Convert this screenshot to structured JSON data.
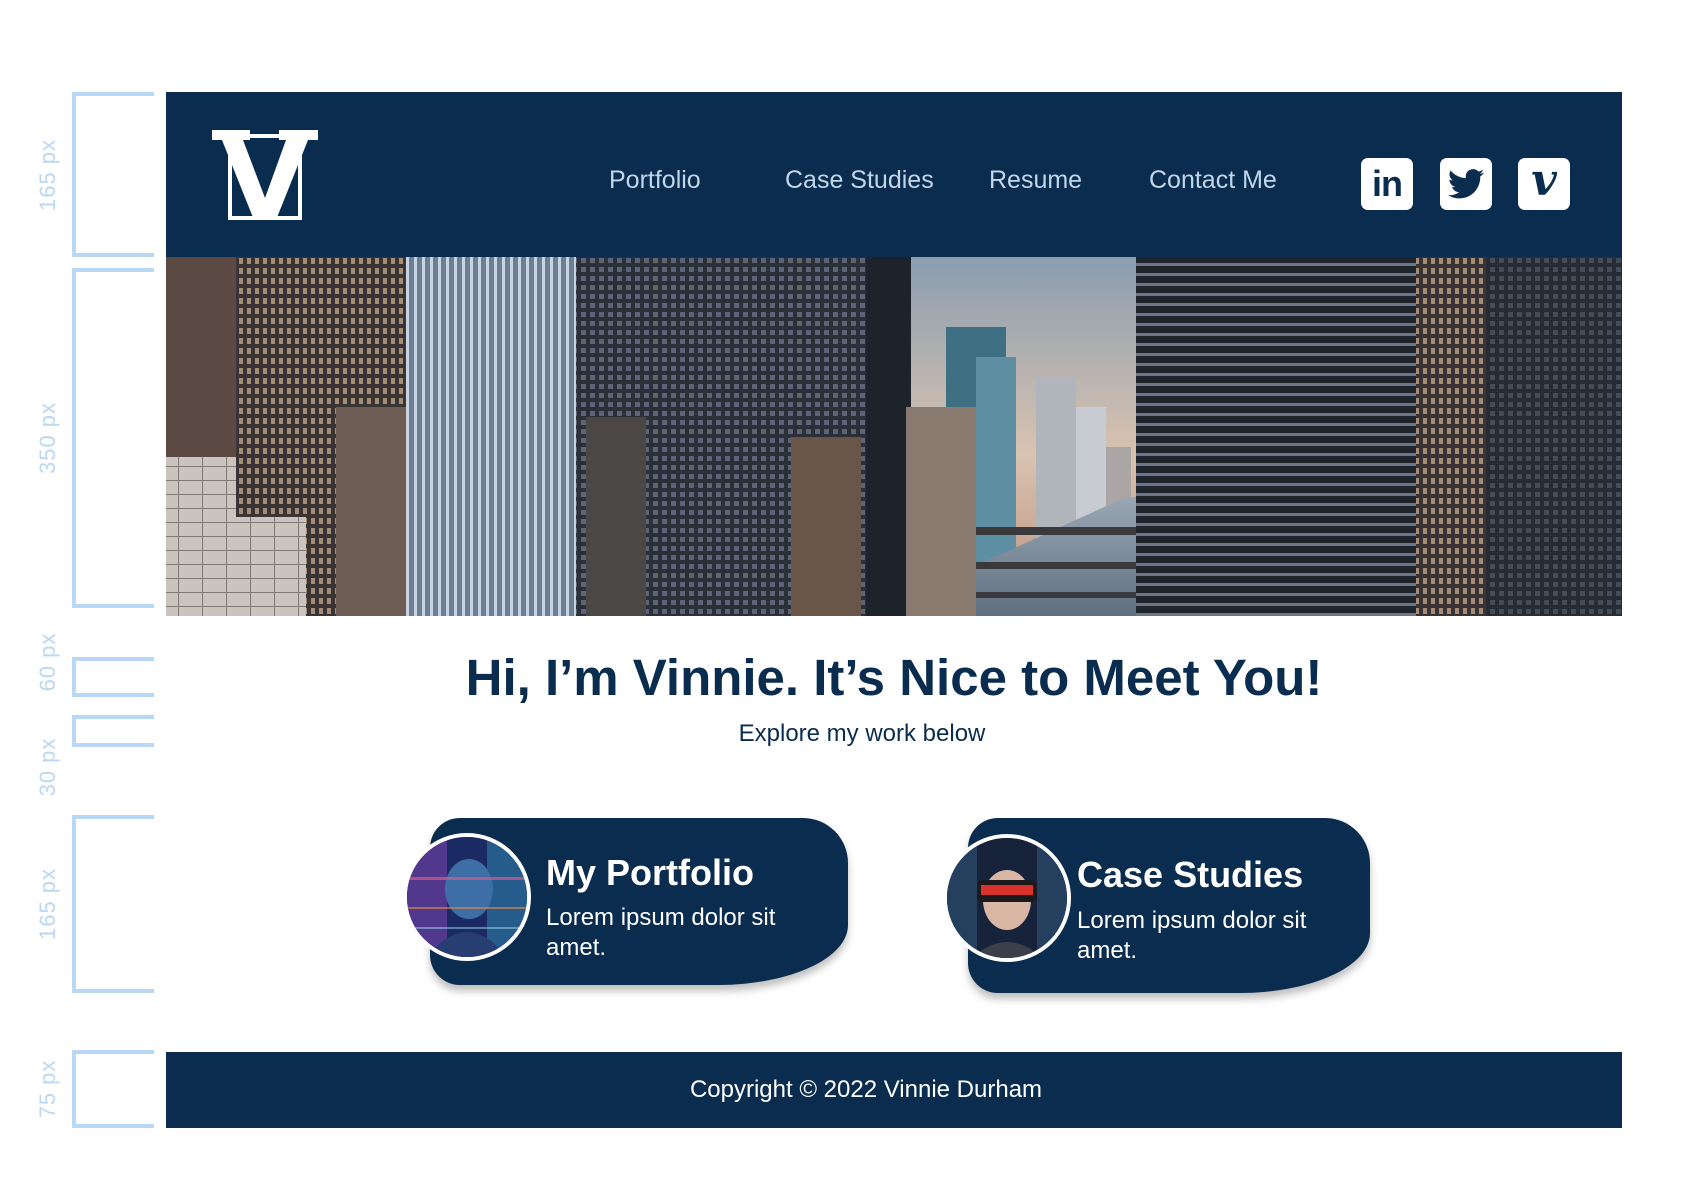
{
  "annotations": [
    {
      "label": "165 px"
    },
    {
      "label": "350 px"
    },
    {
      "label": "60 px"
    },
    {
      "label": "30 px"
    },
    {
      "label": "165 px"
    },
    {
      "label": "75 px"
    }
  ],
  "header": {
    "logo_letter": "V",
    "nav": [
      "Portfolio",
      "Case Studies",
      "Resume",
      "Contact Me"
    ],
    "social": [
      {
        "icon": "linkedin-icon",
        "glyph": "in"
      },
      {
        "icon": "twitter-icon"
      },
      {
        "icon": "vimeo-icon",
        "glyph": "v"
      }
    ]
  },
  "hero": {
    "image": "city-skyline-photo"
  },
  "intro": {
    "headline": "Hi, I’m Vinnie. It’s Nice to Meet You!",
    "subline": "Explore my work below"
  },
  "cards": [
    {
      "title": "My Portfolio",
      "text": "Lorem ipsum dolor sit amet.",
      "avatar": "person-with-projection-photo"
    },
    {
      "title": "Case Studies",
      "text": "Lorem ipsum dolor sit amet.",
      "avatar": "person-in-vr-headset-photo"
    }
  ],
  "footer": {
    "copyright": "Copyright © 2022 Vinnie Durham"
  },
  "colors": {
    "navy": "#0a2c4e",
    "annotation": "#b9d8f5",
    "nav_text": "#c2d6ea"
  }
}
